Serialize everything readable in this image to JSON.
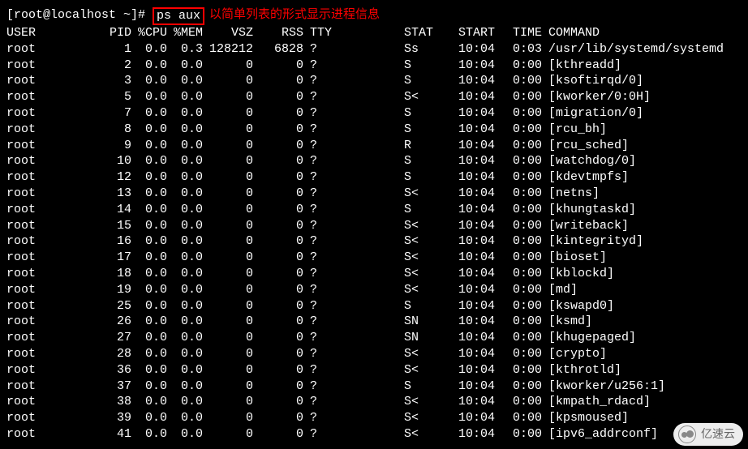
{
  "prompt": "[root@localhost ~]# ",
  "command": "ps aux",
  "annotation": "以简单列表的形式显示进程信息",
  "headers": {
    "user": "USER",
    "pid": "PID",
    "cpu": "%CPU",
    "mem": "%MEM",
    "vsz": "VSZ",
    "rss": "RSS",
    "tty": "TTY",
    "stat": "STAT",
    "start": "START",
    "time": "TIME",
    "cmd": "COMMAND"
  },
  "rows": [
    {
      "user": "root",
      "pid": "1",
      "cpu": "0.0",
      "mem": "0.3",
      "vsz": "128212",
      "rss": "6828",
      "tty": "?",
      "stat": "Ss",
      "start": "10:04",
      "time": "0:03",
      "cmd": "/usr/lib/systemd/systemd"
    },
    {
      "user": "root",
      "pid": "2",
      "cpu": "0.0",
      "mem": "0.0",
      "vsz": "0",
      "rss": "0",
      "tty": "?",
      "stat": "S",
      "start": "10:04",
      "time": "0:00",
      "cmd": "[kthreadd]"
    },
    {
      "user": "root",
      "pid": "3",
      "cpu": "0.0",
      "mem": "0.0",
      "vsz": "0",
      "rss": "0",
      "tty": "?",
      "stat": "S",
      "start": "10:04",
      "time": "0:00",
      "cmd": "[ksoftirqd/0]"
    },
    {
      "user": "root",
      "pid": "5",
      "cpu": "0.0",
      "mem": "0.0",
      "vsz": "0",
      "rss": "0",
      "tty": "?",
      "stat": "S<",
      "start": "10:04",
      "time": "0:00",
      "cmd": "[kworker/0:0H]"
    },
    {
      "user": "root",
      "pid": "7",
      "cpu": "0.0",
      "mem": "0.0",
      "vsz": "0",
      "rss": "0",
      "tty": "?",
      "stat": "S",
      "start": "10:04",
      "time": "0:00",
      "cmd": "[migration/0]"
    },
    {
      "user": "root",
      "pid": "8",
      "cpu": "0.0",
      "mem": "0.0",
      "vsz": "0",
      "rss": "0",
      "tty": "?",
      "stat": "S",
      "start": "10:04",
      "time": "0:00",
      "cmd": "[rcu_bh]"
    },
    {
      "user": "root",
      "pid": "9",
      "cpu": "0.0",
      "mem": "0.0",
      "vsz": "0",
      "rss": "0",
      "tty": "?",
      "stat": "R",
      "start": "10:04",
      "time": "0:00",
      "cmd": "[rcu_sched]"
    },
    {
      "user": "root",
      "pid": "10",
      "cpu": "0.0",
      "mem": "0.0",
      "vsz": "0",
      "rss": "0",
      "tty": "?",
      "stat": "S",
      "start": "10:04",
      "time": "0:00",
      "cmd": "[watchdog/0]"
    },
    {
      "user": "root",
      "pid": "12",
      "cpu": "0.0",
      "mem": "0.0",
      "vsz": "0",
      "rss": "0",
      "tty": "?",
      "stat": "S",
      "start": "10:04",
      "time": "0:00",
      "cmd": "[kdevtmpfs]"
    },
    {
      "user": "root",
      "pid": "13",
      "cpu": "0.0",
      "mem": "0.0",
      "vsz": "0",
      "rss": "0",
      "tty": "?",
      "stat": "S<",
      "start": "10:04",
      "time": "0:00",
      "cmd": "[netns]"
    },
    {
      "user": "root",
      "pid": "14",
      "cpu": "0.0",
      "mem": "0.0",
      "vsz": "0",
      "rss": "0",
      "tty": "?",
      "stat": "S",
      "start": "10:04",
      "time": "0:00",
      "cmd": "[khungtaskd]"
    },
    {
      "user": "root",
      "pid": "15",
      "cpu": "0.0",
      "mem": "0.0",
      "vsz": "0",
      "rss": "0",
      "tty": "?",
      "stat": "S<",
      "start": "10:04",
      "time": "0:00",
      "cmd": "[writeback]"
    },
    {
      "user": "root",
      "pid": "16",
      "cpu": "0.0",
      "mem": "0.0",
      "vsz": "0",
      "rss": "0",
      "tty": "?",
      "stat": "S<",
      "start": "10:04",
      "time": "0:00",
      "cmd": "[kintegrityd]"
    },
    {
      "user": "root",
      "pid": "17",
      "cpu": "0.0",
      "mem": "0.0",
      "vsz": "0",
      "rss": "0",
      "tty": "?",
      "stat": "S<",
      "start": "10:04",
      "time": "0:00",
      "cmd": "[bioset]"
    },
    {
      "user": "root",
      "pid": "18",
      "cpu": "0.0",
      "mem": "0.0",
      "vsz": "0",
      "rss": "0",
      "tty": "?",
      "stat": "S<",
      "start": "10:04",
      "time": "0:00",
      "cmd": "[kblockd]"
    },
    {
      "user": "root",
      "pid": "19",
      "cpu": "0.0",
      "mem": "0.0",
      "vsz": "0",
      "rss": "0",
      "tty": "?",
      "stat": "S<",
      "start": "10:04",
      "time": "0:00",
      "cmd": "[md]"
    },
    {
      "user": "root",
      "pid": "25",
      "cpu": "0.0",
      "mem": "0.0",
      "vsz": "0",
      "rss": "0",
      "tty": "?",
      "stat": "S",
      "start": "10:04",
      "time": "0:00",
      "cmd": "[kswapd0]"
    },
    {
      "user": "root",
      "pid": "26",
      "cpu": "0.0",
      "mem": "0.0",
      "vsz": "0",
      "rss": "0",
      "tty": "?",
      "stat": "SN",
      "start": "10:04",
      "time": "0:00",
      "cmd": "[ksmd]"
    },
    {
      "user": "root",
      "pid": "27",
      "cpu": "0.0",
      "mem": "0.0",
      "vsz": "0",
      "rss": "0",
      "tty": "?",
      "stat": "SN",
      "start": "10:04",
      "time": "0:00",
      "cmd": "[khugepaged]"
    },
    {
      "user": "root",
      "pid": "28",
      "cpu": "0.0",
      "mem": "0.0",
      "vsz": "0",
      "rss": "0",
      "tty": "?",
      "stat": "S<",
      "start": "10:04",
      "time": "0:00",
      "cmd": "[crypto]"
    },
    {
      "user": "root",
      "pid": "36",
      "cpu": "0.0",
      "mem": "0.0",
      "vsz": "0",
      "rss": "0",
      "tty": "?",
      "stat": "S<",
      "start": "10:04",
      "time": "0:00",
      "cmd": "[kthrotld]"
    },
    {
      "user": "root",
      "pid": "37",
      "cpu": "0.0",
      "mem": "0.0",
      "vsz": "0",
      "rss": "0",
      "tty": "?",
      "stat": "S",
      "start": "10:04",
      "time": "0:00",
      "cmd": "[kworker/u256:1]"
    },
    {
      "user": "root",
      "pid": "38",
      "cpu": "0.0",
      "mem": "0.0",
      "vsz": "0",
      "rss": "0",
      "tty": "?",
      "stat": "S<",
      "start": "10:04",
      "time": "0:00",
      "cmd": "[kmpath_rdacd]"
    },
    {
      "user": "root",
      "pid": "39",
      "cpu": "0.0",
      "mem": "0.0",
      "vsz": "0",
      "rss": "0",
      "tty": "?",
      "stat": "S<",
      "start": "10:04",
      "time": "0:00",
      "cmd": "[kpsmoused]"
    },
    {
      "user": "root",
      "pid": "41",
      "cpu": "0.0",
      "mem": "0.0",
      "vsz": "0",
      "rss": "0",
      "tty": "?",
      "stat": "S<",
      "start": "10:04",
      "time": "0:00",
      "cmd": "[ipv6_addrconf]"
    }
  ],
  "watermark": "亿速云"
}
